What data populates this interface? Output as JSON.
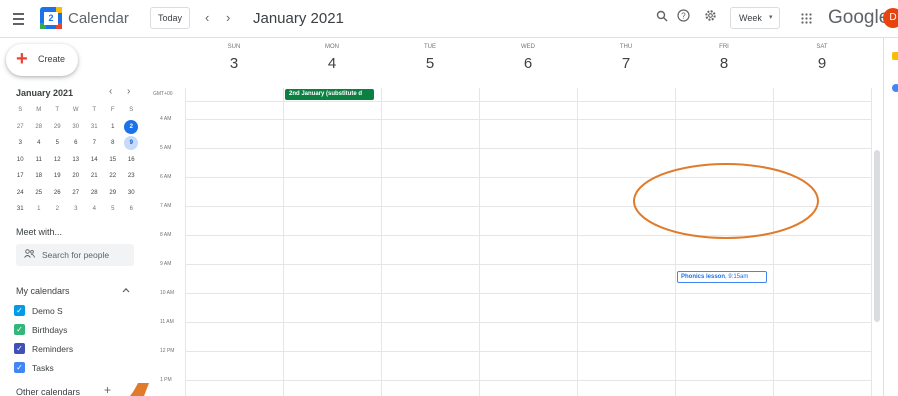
{
  "header": {
    "app_title": "Calendar",
    "logo_number": "2",
    "today_label": "Today",
    "prev_symbol": "‹",
    "next_symbol": "›",
    "month_title": "January 2021",
    "view_label": "Week",
    "google_word": "Google",
    "avatar_letter": "D"
  },
  "sidebar": {
    "create_label": "Create",
    "mini_calendar": {
      "title": "January 2021",
      "weekday_heads": [
        "S",
        "M",
        "T",
        "W",
        "T",
        "F",
        "S"
      ],
      "weeks": [
        [
          "27",
          "28",
          "29",
          "30",
          "31",
          "1",
          "2"
        ],
        [
          "3",
          "4",
          "5",
          "6",
          "7",
          "8",
          "9"
        ],
        [
          "10",
          "11",
          "12",
          "13",
          "14",
          "15",
          "16"
        ],
        [
          "17",
          "18",
          "19",
          "20",
          "21",
          "22",
          "23"
        ],
        [
          "24",
          "25",
          "26",
          "27",
          "28",
          "29",
          "30"
        ],
        [
          "31",
          "1",
          "2",
          "3",
          "4",
          "5",
          "6"
        ]
      ],
      "today": "2",
      "selected": "9"
    },
    "meet_title": "Meet with...",
    "search_people_placeholder": "Search for people",
    "my_calendars_title": "My calendars",
    "calendars": [
      {
        "label": "Demo S",
        "color": "#039be5"
      },
      {
        "label": "Birthdays",
        "color": "#33b679"
      },
      {
        "label": "Reminders",
        "color": "#3f51b5"
      },
      {
        "label": "Tasks",
        "color": "#4285f4"
      }
    ],
    "other_calendars_title": "Other calendars",
    "other_add_symbol": "+"
  },
  "week": {
    "days": [
      {
        "abbr": "SUN",
        "num": "3"
      },
      {
        "abbr": "MON",
        "num": "4"
      },
      {
        "abbr": "TUE",
        "num": "5"
      },
      {
        "abbr": "WED",
        "num": "6"
      },
      {
        "abbr": "THU",
        "num": "7"
      },
      {
        "abbr": "FRI",
        "num": "8"
      },
      {
        "abbr": "SAT",
        "num": "9"
      }
    ],
    "gmt_label": "GMT+00",
    "hours": [
      "4 AM",
      "5 AM",
      "6 AM",
      "7 AM",
      "8 AM",
      "9 AM",
      "10 AM",
      "11 AM",
      "12 PM",
      "1 PM"
    ],
    "allday_event": {
      "title": "2nd January (substitute d",
      "color": "#0b8043"
    },
    "event": {
      "title": "Phonics lesson",
      "time": ", 9:15am",
      "color": "#4285f4"
    }
  },
  "colors": {
    "accent": "#1a73e8",
    "annotation": "#e07b2c"
  }
}
